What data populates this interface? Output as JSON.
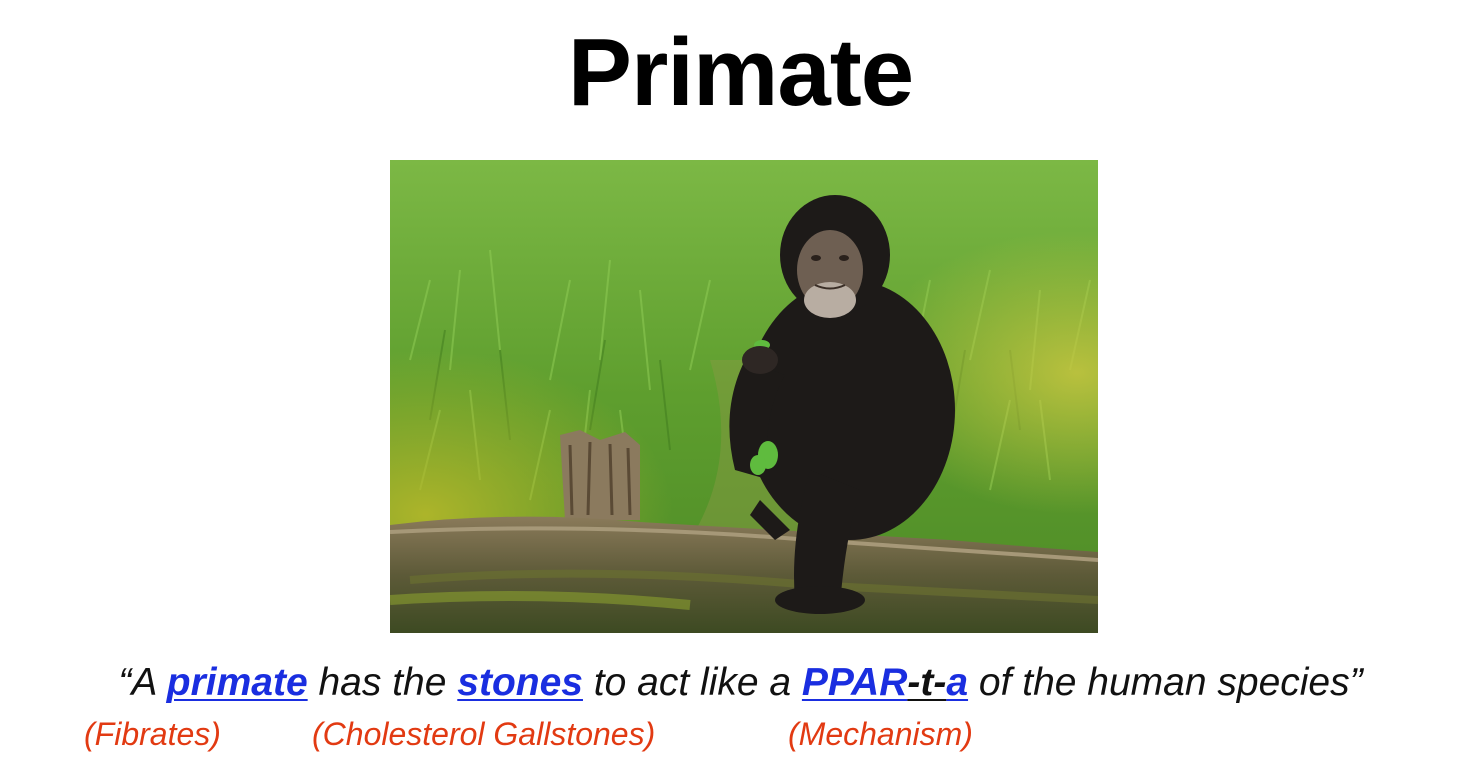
{
  "slide": {
    "title": "Primate"
  },
  "photo": {
    "subject": "chimpanzee-sitting-on-log"
  },
  "quote": {
    "open": "“A ",
    "kw1": "primate",
    "mid1": " has the ",
    "kw2": "stones",
    "mid2": " to act like a ",
    "kw3a": "PPAR",
    "kw3b": "-t-",
    "kw3c": "a",
    "end": " of the human species”"
  },
  "notes": {
    "fibrates": "(Fibrates)",
    "gallstones": "(Cholesterol Gallstones)",
    "mechanism": "(Mechanism)"
  },
  "colors": {
    "keyword": "#1a2ee0",
    "note": "#e23a12"
  }
}
